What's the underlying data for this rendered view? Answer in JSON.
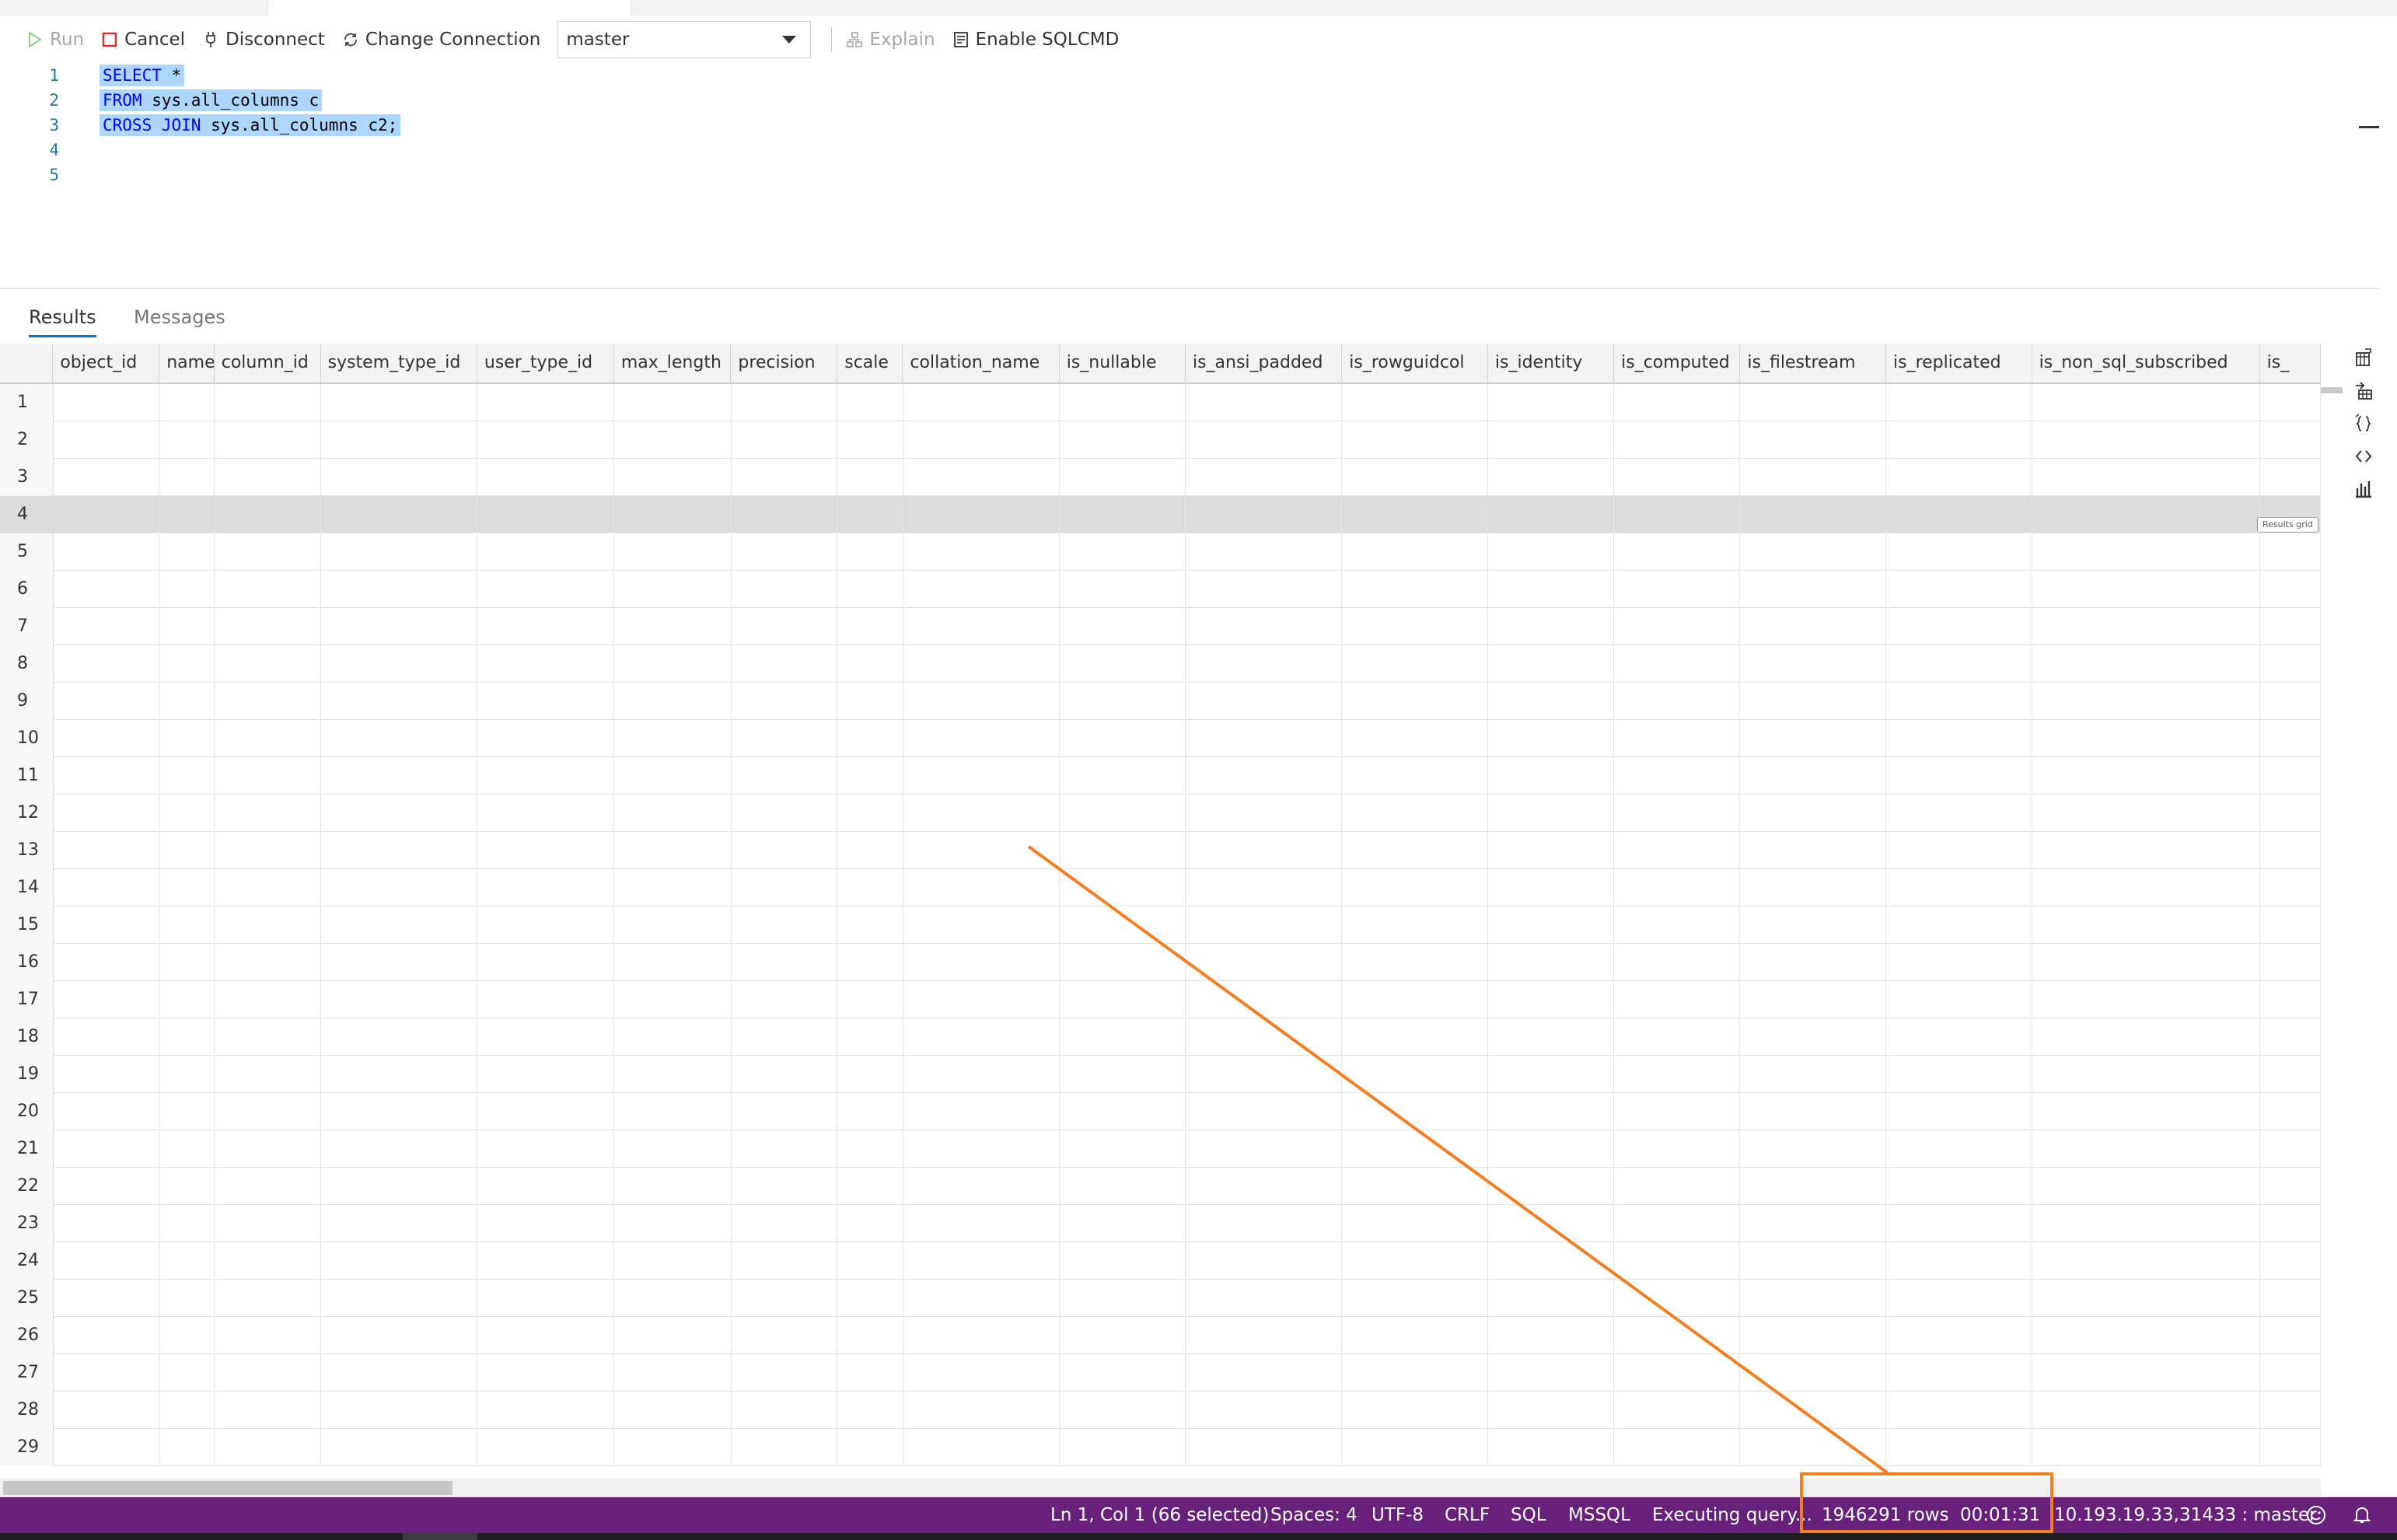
{
  "toolbar": {
    "run_label": "Run",
    "cancel_label": "Cancel",
    "disconnect_label": "Disconnect",
    "change_connection_label": "Change Connection",
    "database": "master",
    "explain_label": "Explain",
    "sqlcmd_label": "Enable SQLCMD"
  },
  "editor": {
    "line_numbers": [
      "1",
      "2",
      "3",
      "4",
      "5"
    ],
    "lines": [
      {
        "keyword": "SELECT",
        "rest": " *"
      },
      {
        "keyword": "FROM",
        "rest": " sys.all_columns c"
      },
      {
        "keyword": "CROSS JOIN",
        "rest": " sys.all_columns c2;"
      }
    ]
  },
  "results": {
    "tabs": [
      "Results",
      "Messages"
    ],
    "columns": [
      "object_id",
      "name",
      "column_id",
      "system_type_id",
      "user_type_id",
      "max_length",
      "precision",
      "scale",
      "collation_name",
      "is_nullable",
      "is_ansi_padded",
      "is_rowguidcol",
      "is_identity",
      "is_computed",
      "is_filestream",
      "is_replicated",
      "is_non_sql_subscribed",
      "is_"
    ],
    "row_numbers": [
      "1",
      "2",
      "3",
      "4",
      "5",
      "6",
      "7",
      "8",
      "9",
      "10",
      "11",
      "12",
      "13",
      "14",
      "15",
      "16",
      "17",
      "18",
      "19",
      "20",
      "21",
      "22",
      "23",
      "24",
      "25",
      "26",
      "27",
      "28",
      "29"
    ],
    "selected_row": 4,
    "tooltip": "Results grid"
  },
  "statusbar": {
    "cursor": "Ln 1, Col 1 (66 selected)",
    "spaces": "Spaces: 4",
    "encoding": "UTF-8",
    "eol": "CRLF",
    "language": "SQL",
    "provider": "MSSQL",
    "executing": "Executing query...",
    "rows": "1946291 rows",
    "elapsed": "00:01:31",
    "connection": "10.193.19.33,31433 : master"
  },
  "icons": {
    "run": "play-icon",
    "cancel": "stop-icon",
    "disconnect": "plug-icon",
    "change_connection": "connection-icon",
    "explain": "explain-icon",
    "sqlcmd": "sqlcmd-icon",
    "actions": [
      "save-csv-icon",
      "save-excel-icon",
      "save-json-icon",
      "save-xml-icon",
      "chart-icon"
    ]
  },
  "colors": {
    "statusbar": "#68217a",
    "annotation": "#f28022",
    "selection": "#add6ff",
    "keyword": "#0000ff"
  }
}
